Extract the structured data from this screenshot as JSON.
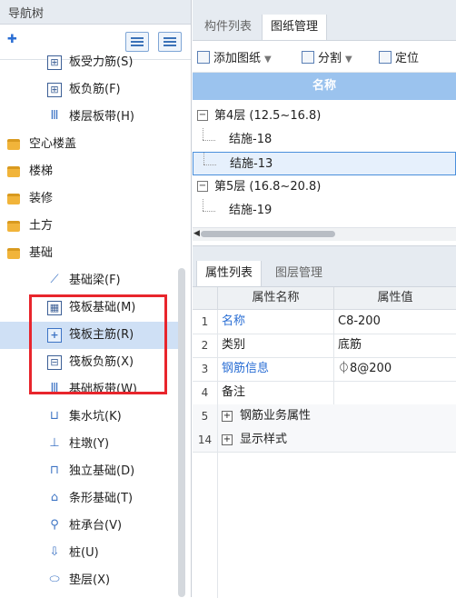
{
  "nav": {
    "title": "导航树",
    "add_icon": "✚",
    "tree": [
      {
        "label": "板受力筋(S)",
        "icon": "grid-icon",
        "indent": 2
      },
      {
        "label": "板负筋(F)",
        "icon": "grid-icon",
        "indent": 2
      },
      {
        "label": "楼层板带(H)",
        "icon": "column-icon",
        "indent": 2
      },
      {
        "label": "空心楼盖",
        "icon": "folder-icon",
        "indent": 0
      },
      {
        "label": "楼梯",
        "icon": "folder-icon",
        "indent": 0
      },
      {
        "label": "装修",
        "icon": "folder-icon",
        "indent": 0
      },
      {
        "label": "土方",
        "icon": "folder-icon",
        "indent": 0
      },
      {
        "label": "基础",
        "icon": "folder-open-icon",
        "indent": 0
      },
      {
        "label": "基础梁(F)",
        "icon": "beam-icon",
        "indent": 2
      },
      {
        "label": "筏板基础(M)",
        "icon": "raft-foundation-icon",
        "indent": 2
      },
      {
        "label": "筏板主筋(R)",
        "icon": "raft-main-rebar-icon",
        "indent": 2,
        "selected": true
      },
      {
        "label": "筏板负筋(X)",
        "icon": "raft-neg-rebar-icon",
        "indent": 2
      },
      {
        "label": "基础板带(W)",
        "icon": "column-icon",
        "indent": 2
      },
      {
        "label": "集水坑(K)",
        "icon": "sump-icon",
        "indent": 2
      },
      {
        "label": "柱墩(Y)",
        "icon": "pier-icon",
        "indent": 2
      },
      {
        "label": "独立基础(D)",
        "icon": "isolated-footing-icon",
        "indent": 2
      },
      {
        "label": "条形基础(T)",
        "icon": "strip-footing-icon",
        "indent": 2
      },
      {
        "label": "桩承台(V)",
        "icon": "pile-cap-icon",
        "indent": 2
      },
      {
        "label": "桩(U)",
        "icon": "pile-icon",
        "indent": 2
      },
      {
        "label": "垫层(X)",
        "icon": "cushion-icon",
        "indent": 2
      }
    ]
  },
  "drawings": {
    "tabs": [
      {
        "label": "构件列表"
      },
      {
        "label": "图纸管理",
        "active": true
      }
    ],
    "toolbar": {
      "add": "添加图纸",
      "split": "分割",
      "locate": "定位"
    },
    "column_header": "名称",
    "rows": [
      {
        "label": "第4层 (12.5~16.8)",
        "group": true
      },
      {
        "label": "结施-18"
      },
      {
        "label": "结施-13",
        "selected": true
      },
      {
        "label": "第5层 (16.8~20.8)",
        "group": true
      },
      {
        "label": "结施-19"
      }
    ]
  },
  "properties": {
    "tabs": [
      {
        "label": "属性列表",
        "active": true
      },
      {
        "label": "图层管理"
      }
    ],
    "headers": {
      "name": "属性名称",
      "value": "属性值"
    },
    "rows": [
      {
        "num": "1",
        "name": "名称",
        "value": "C8-200",
        "blue": true
      },
      {
        "num": "2",
        "name": "类别",
        "value": "底筋"
      },
      {
        "num": "3",
        "name": "钢筋信息",
        "value": "⏀8@200",
        "blue": true
      },
      {
        "num": "4",
        "name": "备注",
        "value": ""
      },
      {
        "num": "5",
        "name": "钢筋业务属性",
        "value": "",
        "group": true
      },
      {
        "num": "14",
        "name": "显示样式",
        "value": "",
        "group": true
      }
    ]
  },
  "colors": {
    "highlight": "#e8252c",
    "accent": "#2a6ed4",
    "header_blue": "#9bc3ee"
  }
}
